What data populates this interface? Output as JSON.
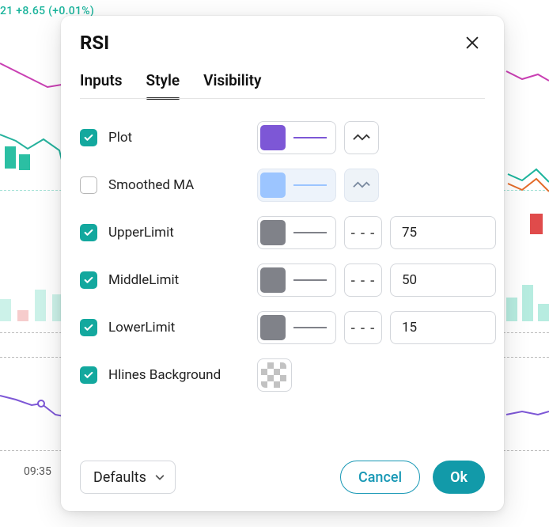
{
  "backdrop": {
    "gain_text": "21 +8.65 (+0.01%)",
    "time_label": "09:35"
  },
  "dialog": {
    "title": "RSI",
    "tabs": {
      "inputs": "Inputs",
      "style": "Style",
      "visibility": "Visibility",
      "active": "style"
    },
    "rows": {
      "plot": {
        "label": "Plot",
        "checked": true,
        "swatch_color": "#7d57d6",
        "line_color": "#7d57d6",
        "line_dashed": false
      },
      "smoothed": {
        "label": "Smoothed MA",
        "checked": false,
        "swatch_color": "#9cc5ff",
        "line_color": "#9cc5ff",
        "line_dashed": false
      },
      "upper": {
        "label": "UpperLimit",
        "checked": true,
        "swatch_color": "#808289",
        "line_color": "#808289",
        "value": "75"
      },
      "middle": {
        "label": "MiddleLimit",
        "checked": true,
        "swatch_color": "#808289",
        "line_color": "#808289",
        "value": "50"
      },
      "lower": {
        "label": "LowerLimit",
        "checked": true,
        "swatch_color": "#808289",
        "line_color": "#808289",
        "value": "15"
      },
      "hlines": {
        "label": "Hlines Background",
        "checked": true
      }
    },
    "dash_glyph": "- - -",
    "footer": {
      "defaults": "Defaults",
      "cancel": "Cancel",
      "ok": "Ok"
    }
  }
}
